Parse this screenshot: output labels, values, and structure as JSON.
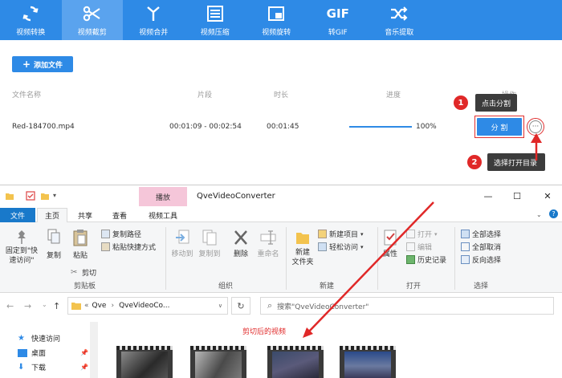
{
  "toolbar": {
    "items": [
      {
        "label": "视频转换",
        "icon": "convert-icon"
      },
      {
        "label": "视频截剪",
        "icon": "scissors-icon"
      },
      {
        "label": "视频合并",
        "icon": "merge-icon"
      },
      {
        "label": "视频压缩",
        "icon": "compress-icon"
      },
      {
        "label": "视频旋转",
        "icon": "rotate-icon"
      },
      {
        "label": "转GIF",
        "icon": "gif-icon"
      },
      {
        "label": "音乐提取",
        "icon": "shuffle-icon"
      }
    ],
    "gif_text": "GIF"
  },
  "app": {
    "add_button": "添加文件",
    "headers": {
      "name": "文件名称",
      "segment": "片段",
      "duration": "时长",
      "progress": "进度",
      "action": "操作"
    },
    "row": {
      "name": "Red-184700.mp4",
      "segment": "00:01:09 - 00:02:54",
      "duration": "00:01:45",
      "progress_text": "100%",
      "progress": 1.0
    },
    "split_button": "分 割",
    "more_button": "···",
    "annotations": [
      {
        "number": "1",
        "text": "点击分割"
      },
      {
        "number": "2",
        "text": "选择打开目录"
      }
    ]
  },
  "explorer": {
    "context_tab": "播放",
    "title": "QveVideoConverter",
    "tabs": [
      "文件",
      "主页",
      "共享",
      "查看",
      "视频工具"
    ],
    "ribbon": {
      "pin_label": "固定到\"快\n速访问\"",
      "copy": "复制",
      "paste": "粘贴",
      "copy_path": "复制路径",
      "paste_shortcut": "粘贴快捷方式",
      "cut": "剪切",
      "clipboard_group": "剪贴板",
      "move_to": "移动到",
      "copy_to": "复制到",
      "delete": "删除",
      "rename": "重命名",
      "organize_group": "组织",
      "new_folder": "新建\n文件夹",
      "new_item": "新建项目",
      "easy_access": "轻松访问",
      "new_group": "新建",
      "properties": "属性",
      "open": "打开",
      "edit": "编辑",
      "history": "历史记录",
      "open_group": "打开",
      "select_all": "全部选择",
      "select_none": "全部取消",
      "invert_selection": "反向选择",
      "select_group": "选择"
    },
    "address": {
      "prefix": "«",
      "part1": "Qve",
      "part2": "QveVideoCo..."
    },
    "search_placeholder": "搜索\"QveVideoConverter\"",
    "nav": [
      "快速访问",
      "桌面",
      "下载"
    ],
    "content_label": "剪切后的视频"
  },
  "colors": {
    "accent": "#2e8ae6",
    "annotation": "#e02828",
    "tooltip": "#3c3c3c",
    "context_tab": "#f5c6d9"
  }
}
